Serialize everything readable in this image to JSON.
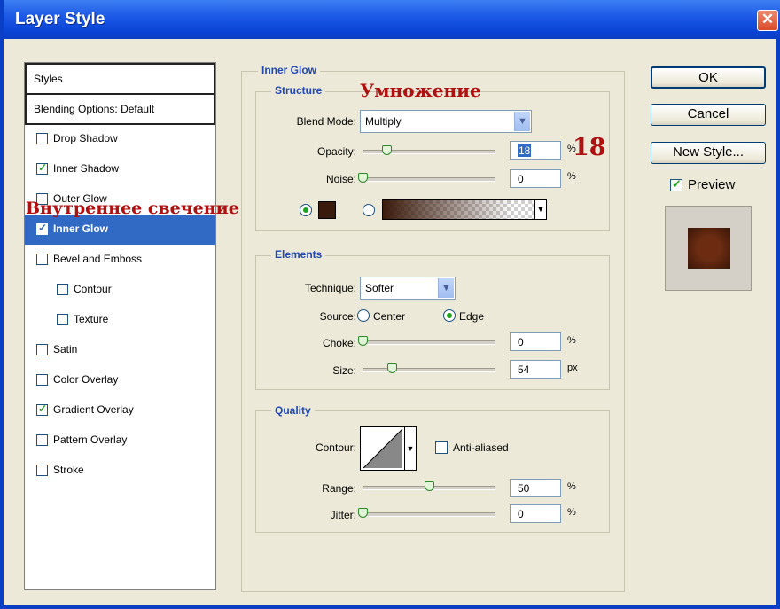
{
  "window": {
    "title": "Layer Style",
    "close_glyph": "✕"
  },
  "styles_list": {
    "header": "Styles",
    "blending": "Blending Options: Default",
    "items": [
      {
        "label": "Drop Shadow",
        "checked": false,
        "indent": false,
        "active": false
      },
      {
        "label": "Inner Shadow",
        "checked": true,
        "indent": false,
        "active": false
      },
      {
        "label": "Outer Glow",
        "checked": false,
        "indent": false,
        "active": false
      },
      {
        "label": "Inner Glow",
        "checked": true,
        "indent": false,
        "active": true
      },
      {
        "label": "Bevel and Emboss",
        "checked": false,
        "indent": false,
        "active": false
      },
      {
        "label": "Contour",
        "checked": false,
        "indent": true,
        "active": false
      },
      {
        "label": "Texture",
        "checked": false,
        "indent": true,
        "active": false
      },
      {
        "label": "Satin",
        "checked": false,
        "indent": false,
        "active": false
      },
      {
        "label": "Color Overlay",
        "checked": false,
        "indent": false,
        "active": false
      },
      {
        "label": "Gradient Overlay",
        "checked": true,
        "indent": false,
        "active": false
      },
      {
        "label": "Pattern Overlay",
        "checked": false,
        "indent": false,
        "active": false
      },
      {
        "label": "Stroke",
        "checked": false,
        "indent": false,
        "active": false
      }
    ]
  },
  "inner_glow": {
    "title": "Inner Glow",
    "structure": {
      "title": "Structure",
      "blend_mode_label": "Blend Mode:",
      "blend_mode_value": "Multiply",
      "opacity_label": "Opacity:",
      "opacity_value": "18",
      "opacity_unit": "%",
      "opacity_fraction": 0.18,
      "noise_label": "Noise:",
      "noise_value": "0",
      "noise_unit": "%",
      "noise_fraction": 0,
      "glow_color": "#3a1a0c"
    },
    "elements": {
      "title": "Elements",
      "technique_label": "Technique:",
      "technique_value": "Softer",
      "source_label": "Source:",
      "source_center": "Center",
      "source_edge": "Edge",
      "source_selected": "Edge",
      "choke_label": "Choke:",
      "choke_value": "0",
      "choke_unit": "%",
      "choke_fraction": 0,
      "size_label": "Size:",
      "size_value": "54",
      "size_unit": "px",
      "size_fraction": 0.22
    },
    "quality": {
      "title": "Quality",
      "contour_label": "Contour:",
      "anti_aliased_label": "Anti-aliased",
      "anti_aliased_checked": false,
      "range_label": "Range:",
      "range_value": "50",
      "range_unit": "%",
      "range_fraction": 0.5,
      "jitter_label": "Jitter:",
      "jitter_value": "0",
      "jitter_unit": "%",
      "jitter_fraction": 0
    }
  },
  "buttons": {
    "ok": "OK",
    "cancel": "Cancel",
    "new_style": "New Style..."
  },
  "preview": {
    "label": "Preview",
    "checked": true,
    "swatch_color": "#6b2c12"
  },
  "annotations": {
    "inner_glow_ru": "Внутреннее свечение",
    "multiply_ru": "Умножение",
    "opacity_number": "18"
  }
}
